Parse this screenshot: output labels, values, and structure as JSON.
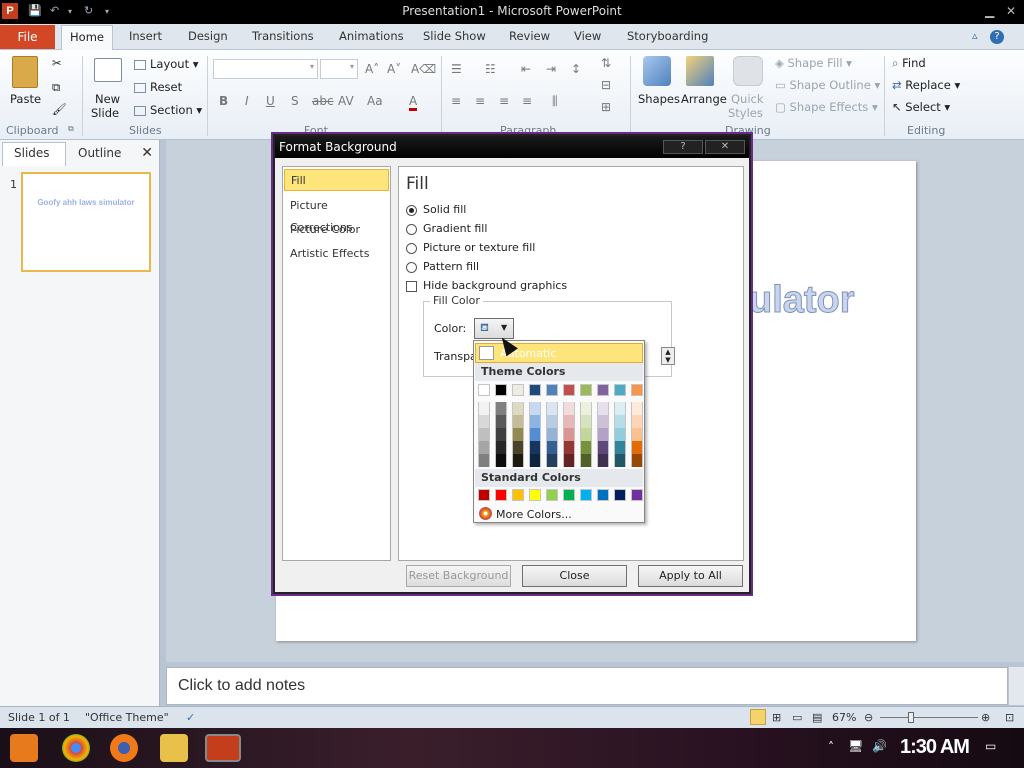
{
  "window": {
    "title": "Presentation1 - Microsoft PowerPoint"
  },
  "ribbon_tabs": [
    "File",
    "Home",
    "Insert",
    "Design",
    "Transitions",
    "Animations",
    "Slide Show",
    "Review",
    "View",
    "Storyboarding"
  ],
  "ribbon": {
    "clipboard": {
      "paste": "Paste",
      "label": "Clipboard"
    },
    "slides": {
      "new_slide_1": "New",
      "new_slide_2": "Slide",
      "layout": "Layout",
      "reset": "Reset",
      "section": "Section",
      "label": "Slides"
    },
    "font": {
      "label": "Font"
    },
    "paragraph": {
      "label": "Paragraph"
    },
    "drawing": {
      "shapes": "Shapes",
      "arrange": "Arrange",
      "quick_styles_1": "Quick",
      "quick_styles_2": "Styles",
      "shape_fill": "Shape Fill",
      "shape_outline": "Shape Outline",
      "shape_effects": "Shape Effects",
      "label": "Drawing"
    },
    "editing": {
      "find": "Find",
      "replace": "Replace",
      "select": "Select",
      "label": "Editing"
    }
  },
  "left_pane": {
    "tab_slides": "Slides",
    "tab_outline": "Outline",
    "close": "✕",
    "slide_number": "1",
    "thumb_text": "Goofy ahh laws simulator"
  },
  "slide": {
    "title_visible": "ulator"
  },
  "notes": {
    "placeholder": "Click to add notes"
  },
  "status": {
    "slide": "Slide 1 of 1",
    "theme": "\"Office Theme\"",
    "zoom": "67%"
  },
  "clock": "1:30 AM",
  "dialog": {
    "title": "Format Background",
    "nav": [
      "Fill",
      "Picture Corrections",
      "Picture Color",
      "Artistic Effects"
    ],
    "heading": "Fill",
    "options": [
      "Solid fill",
      "Gradient fill",
      "Picture or texture fill",
      "Pattern fill"
    ],
    "hide_graphics": "Hide background graphics",
    "fill_color_legend": "Fill Color",
    "color_label": "Color:",
    "transparency_label": "Transpa",
    "buttons": {
      "reset": "Reset Background",
      "close": "Close",
      "apply_all": "Apply to All"
    }
  },
  "color_menu": {
    "automatic": "Automatic",
    "theme_header": "Theme Colors",
    "standard_header": "Standard Colors",
    "more": "More Colors...",
    "theme_top": [
      "#FFFFFF",
      "#000000",
      "#EEECE1",
      "#1F497D",
      "#4F81BD",
      "#C0504D",
      "#9BBB59",
      "#8064A2",
      "#4BACC6",
      "#F79646"
    ],
    "theme_shades": [
      [
        "#F2F2F2",
        "#7F7F7F",
        "#DDD9C3",
        "#C6D9F0",
        "#DBE5F1",
        "#F2DCDB",
        "#EBF1DD",
        "#E5E0EC",
        "#DBEEF3",
        "#FDEADA"
      ],
      [
        "#D8D8D8",
        "#595959",
        "#C4BD97",
        "#8DB3E2",
        "#B8CCE4",
        "#E5B9B7",
        "#D7E3BC",
        "#CCC1D9",
        "#B7DDE8",
        "#FBD5B5"
      ],
      [
        "#BFBFBF",
        "#3F3F3F",
        "#938953",
        "#548DD4",
        "#95B3D7",
        "#D99694",
        "#C3D69B",
        "#B2A2C7",
        "#92CDDC",
        "#FAC08F"
      ],
      [
        "#A5A5A5",
        "#262626",
        "#494429",
        "#17365D",
        "#366092",
        "#953734",
        "#76923C",
        "#5F497A",
        "#31859B",
        "#E36C09"
      ],
      [
        "#7F7F7F",
        "#0C0C0C",
        "#1D1B10",
        "#0F243E",
        "#244061",
        "#632423",
        "#4F6128",
        "#3F3151",
        "#205867",
        "#974806"
      ]
    ],
    "standard": [
      "#C00000",
      "#FF0000",
      "#FFC000",
      "#FFFF00",
      "#92D050",
      "#00B050",
      "#00B0F0",
      "#0070C0",
      "#002060",
      "#7030A0"
    ]
  }
}
